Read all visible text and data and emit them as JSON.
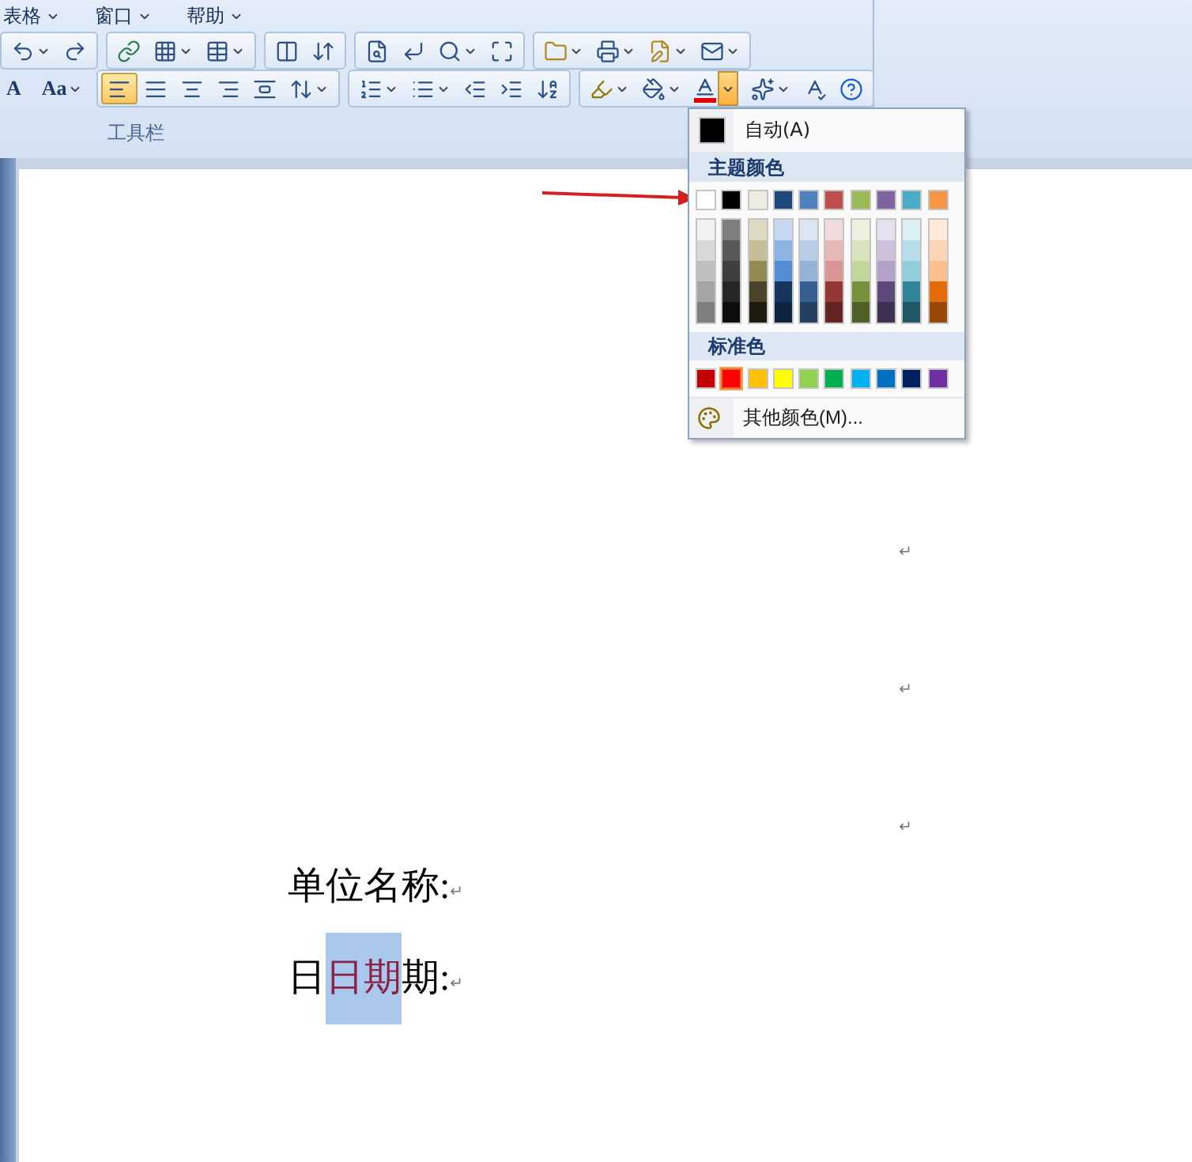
{
  "menu": [
    {
      "label": "表格"
    },
    {
      "label": "窗口"
    },
    {
      "label": "帮助"
    }
  ],
  "toolbar": {
    "text_buttons": [
      {
        "label": "A",
        "dropdown": false
      },
      {
        "label": "Aa",
        "dropdown": true
      }
    ],
    "alignment_buttons": [
      {
        "selected": true
      },
      {
        "selected": false
      },
      {
        "selected": false
      },
      {
        "selected": false
      },
      {
        "selected": false
      }
    ],
    "font_color_button": {
      "expanded": true
    },
    "group_label": "工具栏"
  },
  "color_menu": {
    "automatic": {
      "label": "自动(A)",
      "color": "#000000"
    },
    "theme_heading": "主题颜色",
    "theme_colors": [
      {
        "color": "#ffffff",
        "selected": false,
        "shades": [
          {
            "color": "#f2f2f2"
          },
          {
            "color": "#d8d8d8"
          },
          {
            "color": "#bfbfbf"
          },
          {
            "color": "#a5a5a5"
          },
          {
            "color": "#7f7f7f"
          }
        ]
      },
      {
        "color": "#000000",
        "selected": false,
        "shades": [
          {
            "color": "#7f7f7f"
          },
          {
            "color": "#595959"
          },
          {
            "color": "#3f3f3f"
          },
          {
            "color": "#262626"
          },
          {
            "color": "#0c0c0c"
          }
        ]
      },
      {
        "color": "#eeece1",
        "selected": false,
        "shades": [
          {
            "color": "#ddd9c3"
          },
          {
            "color": "#c4bd97"
          },
          {
            "color": "#938953"
          },
          {
            "color": "#494429"
          },
          {
            "color": "#1d1b10"
          }
        ]
      },
      {
        "color": "#1f497d",
        "selected": false,
        "shades": [
          {
            "color": "#c6d9f0"
          },
          {
            "color": "#8db3e2"
          },
          {
            "color": "#548dd4"
          },
          {
            "color": "#17365d"
          },
          {
            "color": "#0f243e"
          }
        ]
      },
      {
        "color": "#4f81bd",
        "selected": false,
        "shades": [
          {
            "color": "#dbe5f1"
          },
          {
            "color": "#b8cce4"
          },
          {
            "color": "#95b3d7"
          },
          {
            "color": "#366092"
          },
          {
            "color": "#244061"
          }
        ]
      },
      {
        "color": "#c0504d",
        "selected": false,
        "shades": [
          {
            "color": "#f2dcdb"
          },
          {
            "color": "#e5b9b7"
          },
          {
            "color": "#d99694"
          },
          {
            "color": "#953734"
          },
          {
            "color": "#632423"
          }
        ]
      },
      {
        "color": "#9bbb59",
        "selected": false,
        "shades": [
          {
            "color": "#ebf1dd"
          },
          {
            "color": "#d7e3bc"
          },
          {
            "color": "#c3d69b"
          },
          {
            "color": "#76923c"
          },
          {
            "color": "#4f6128"
          }
        ]
      },
      {
        "color": "#8064a2",
        "selected": false,
        "shades": [
          {
            "color": "#e5e0ec"
          },
          {
            "color": "#ccc1d9"
          },
          {
            "color": "#b2a2c7"
          },
          {
            "color": "#5f497a"
          },
          {
            "color": "#3f3151"
          }
        ]
      },
      {
        "color": "#4bacc6",
        "selected": false,
        "shades": [
          {
            "color": "#dbeef3"
          },
          {
            "color": "#b7dde8"
          },
          {
            "color": "#92cddc"
          },
          {
            "color": "#31859b"
          },
          {
            "color": "#205867"
          }
        ]
      },
      {
        "color": "#f79646",
        "selected": false,
        "shades": [
          {
            "color": "#fdeada"
          },
          {
            "color": "#fbd5b5"
          },
          {
            "color": "#fac08f"
          },
          {
            "color": "#e36c09"
          },
          {
            "color": "#974806"
          }
        ]
      }
    ],
    "standard_heading": "标准色",
    "standard_colors": [
      {
        "color": "#c00000",
        "selected": false
      },
      {
        "color": "#ff0000",
        "selected": true
      },
      {
        "color": "#ffc000",
        "selected": false
      },
      {
        "color": "#ffff00",
        "selected": false
      },
      {
        "color": "#92d050",
        "selected": false
      },
      {
        "color": "#00b050",
        "selected": false
      },
      {
        "color": "#00b0f0",
        "selected": false
      },
      {
        "color": "#0070c0",
        "selected": false
      },
      {
        "color": "#002060",
        "selected": false
      },
      {
        "color": "#7030a0",
        "selected": false
      }
    ],
    "more_colors": "其他颜色(M)..."
  },
  "document": {
    "empty_lines": [
      {
        "mark": "↵"
      },
      {
        "mark": "↵"
      },
      {
        "mark": "↵"
      }
    ],
    "lines": [
      {
        "segments": [
          {
            "text": "单位名称:",
            "selected": false,
            "color": "#000000"
          }
        ],
        "mark": "↵"
      },
      {
        "segments": [
          {
            "text": "日",
            "selected": false,
            "color": "#000000"
          },
          {
            "text": "日期",
            "selected": true,
            "color": "#8b2346"
          },
          {
            "text": "期:",
            "selected": false,
            "color": "#000000"
          }
        ],
        "mark": "↵"
      }
    ]
  }
}
